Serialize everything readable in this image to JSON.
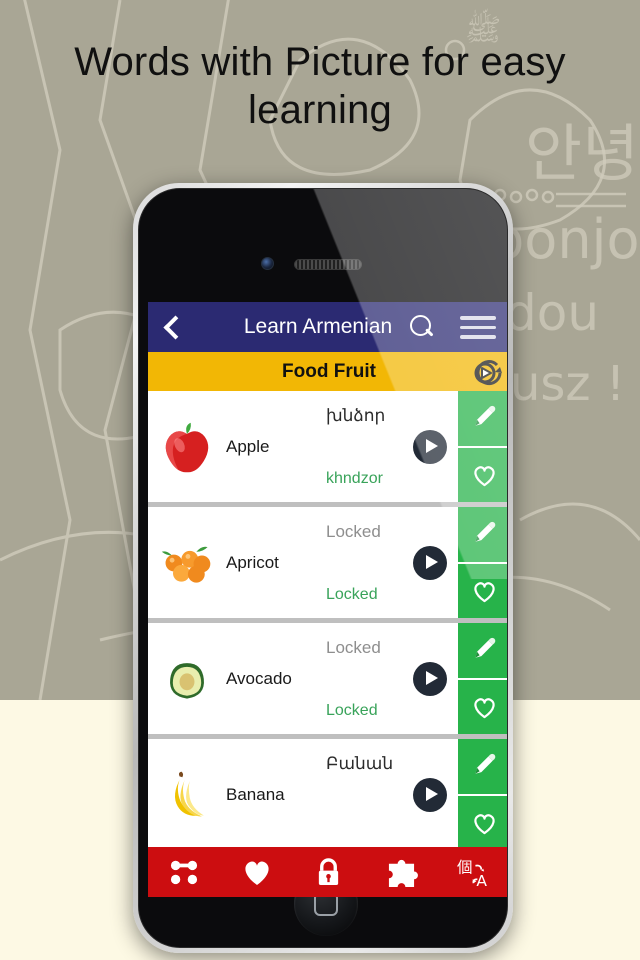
{
  "promo": {
    "headline": "Words with Picture for easy learning"
  },
  "app": {
    "navbar": {
      "back_icon": "back-chevron-icon",
      "title": "Learn Armenian",
      "search_icon": "search-icon",
      "menu_icon": "hamburger-menu-icon"
    },
    "subbar": {
      "title": "Food Fruit",
      "playall_icon": "play-all-repeat-icon"
    },
    "list": [
      {
        "english": "Apple",
        "native": "խնձոր",
        "translit": "khndzor",
        "locked": false,
        "image": "apple-image",
        "play_icon": "play-icon",
        "edit_icon": "pencil-edit-icon",
        "favorite_icon": "heart-outline-icon"
      },
      {
        "english": "Apricot",
        "native": "Locked",
        "translit": "Locked",
        "locked": true,
        "image": "apricot-image",
        "play_icon": "play-icon",
        "edit_icon": "pencil-edit-icon",
        "favorite_icon": "heart-outline-icon"
      },
      {
        "english": "Avocado",
        "native": "Locked",
        "translit": "Locked",
        "locked": true,
        "image": "avocado-image",
        "play_icon": "play-icon",
        "edit_icon": "pencil-edit-icon",
        "favorite_icon": "heart-outline-icon"
      },
      {
        "english": "Banana",
        "native": "Բանան",
        "translit": "",
        "locked": false,
        "image": "banana-image",
        "play_icon": "play-icon",
        "edit_icon": "pencil-edit-icon",
        "favorite_icon": "heart-outline-icon"
      }
    ],
    "toolbar": [
      {
        "name": "match-game-icon",
        "label": "Match"
      },
      {
        "name": "heart-favorites-icon",
        "label": "Favorites"
      },
      {
        "name": "lock-icon",
        "label": "Locked"
      },
      {
        "name": "puzzle-game-icon",
        "label": "Puzzle"
      },
      {
        "name": "translate-icon",
        "label": "Translate"
      }
    ]
  },
  "colors": {
    "navbar": "#2B2A72",
    "subbar": "#F2B705",
    "toolbar": "#CC0D10",
    "action_green": "#27B34A",
    "translit_green": "#39A35A",
    "background_top": "#A9A695",
    "background_bottom": "#FDF9E4"
  }
}
